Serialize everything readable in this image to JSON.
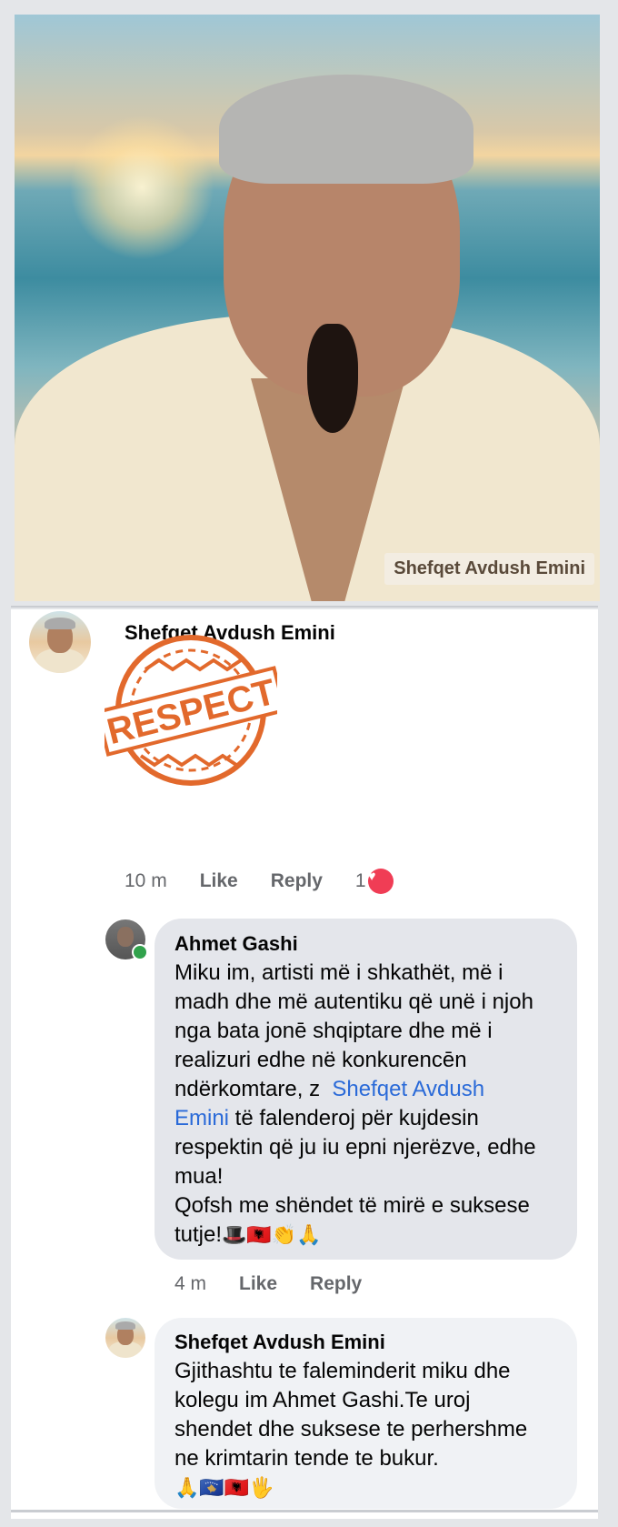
{
  "photo": {
    "caption": "Shefqet Avdush Emini"
  },
  "post_comment": {
    "author": "Shefqet Avdush Emini",
    "sticker_text": "RESPECT",
    "time": "10 m",
    "like_label": "Like",
    "reply_label": "Reply",
    "reaction_count": "1"
  },
  "reply1": {
    "author": "Ahmet Gashi",
    "text_before": "Miku im, artisti më i shkathët, më i\nmadh dhe më autentiku që unë i njoh\nnga bata jonē shqiptare dhe më i\nrealizuri edhe në konkurencēn\nndërkomtare, z  ",
    "mention_line1": "Shefqet Avdush",
    "mention_line2": "Emini",
    "text_after": " të falenderoj për kujdesin\nrespektin që ju iu epni njerëzve, edhe\nmua!\nQofsh me shëndet të mirë e suksese\ntutje!",
    "emojis": "🎩🇦🇱👏🙏",
    "time": "4 m",
    "like_label": "Like",
    "reply_label": "Reply",
    "online": true
  },
  "reply2": {
    "author": "Shefqet Avdush Emini",
    "text": "Gjithashtu te faleminderit miku dhe\nkolegu im Ahmet Gashi.Te uroj\nshendet dhe suksese te perhershme\nne krimtarin tende te bukur.",
    "emojis": "🙏🇽🇰🇦🇱🖐"
  },
  "colors": {
    "sticker_orange": "#e2692c",
    "link_blue": "#2a6ad8",
    "heart_red": "#f03d55",
    "bubble_grey": "#e4e6eb",
    "online_green": "#31a24c"
  }
}
